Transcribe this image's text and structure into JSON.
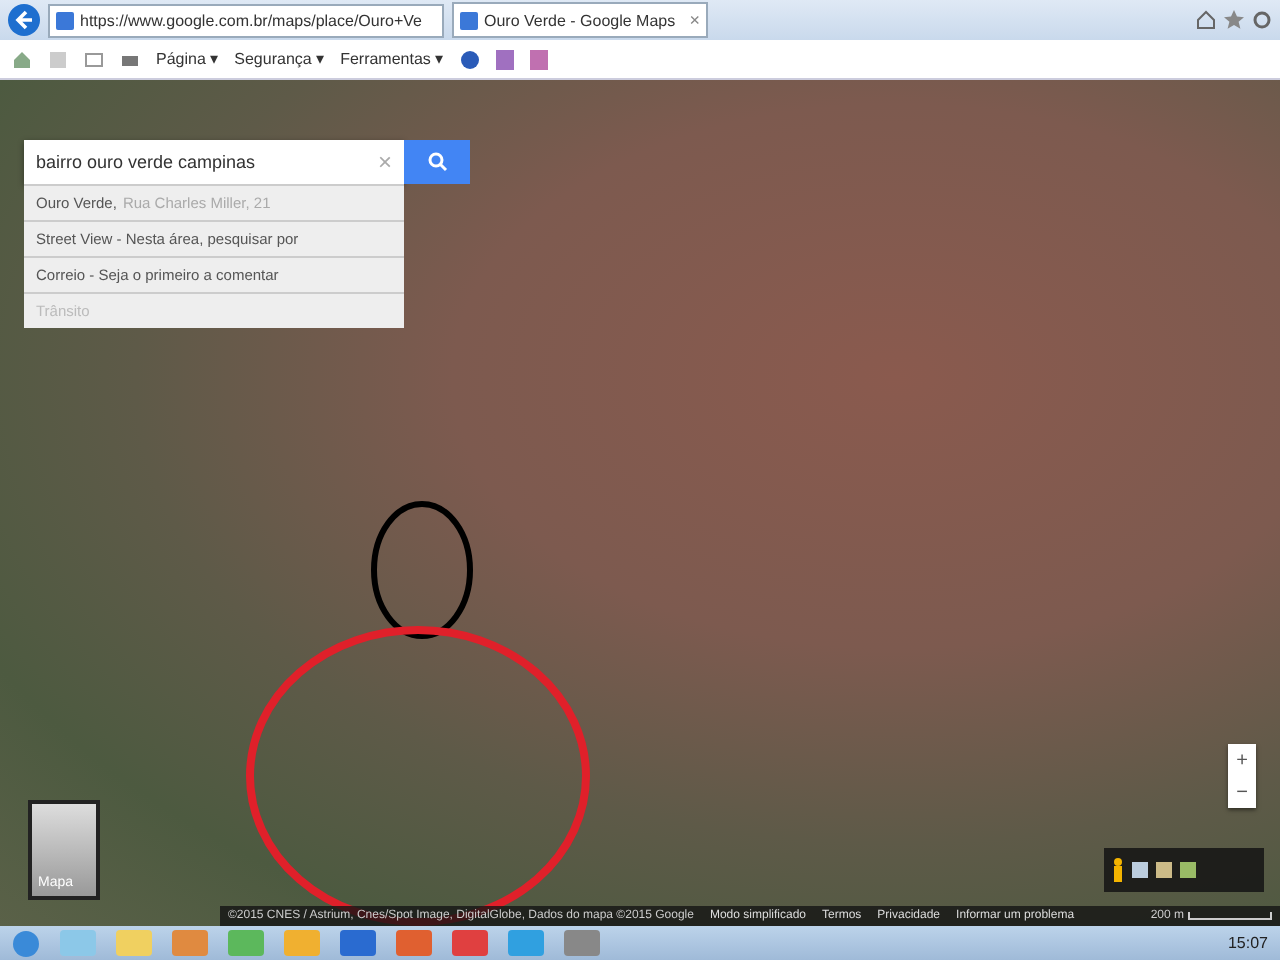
{
  "browser": {
    "address": "https://www.google.com.br/maps/place/Ouro+Ve",
    "tabs": [
      {
        "title": "Ouro Verde - Google Maps",
        "selected": true
      }
    ],
    "close": "×"
  },
  "command_bar": {
    "menus": [
      "Página ▾",
      "Segurança ▾",
      "Ferramentas ▾"
    ]
  },
  "map": {
    "search": {
      "value": "bairro ouro verde campinas",
      "clear": "×"
    },
    "suggestions": [
      {
        "title": "Ouro Verde,",
        "detail": "Rua Charles Miller, 21",
        "disabled": false
      },
      {
        "title": "Street View - Nesta área, pesquisar por",
        "disabled": false
      },
      {
        "title": "Correio - Seja o primeiro a comentar",
        "disabled": false
      },
      {
        "title": "Trânsito",
        "disabled": true
      }
    ],
    "thumbnail": {
      "label": "Mapa"
    },
    "zoom": {
      "plus": "+",
      "minus": "−"
    },
    "footer": {
      "attribution": "©2015 CNES / Astrium, Cnes/Spot Image, DigitalGlobe, Dados do mapa ©2015 Google",
      "links": [
        "Modo simplificado",
        "Termos",
        "Privacidade",
        "Informar um problema"
      ],
      "scale": "200 m"
    }
  },
  "taskbar": {
    "time": "15:07"
  }
}
